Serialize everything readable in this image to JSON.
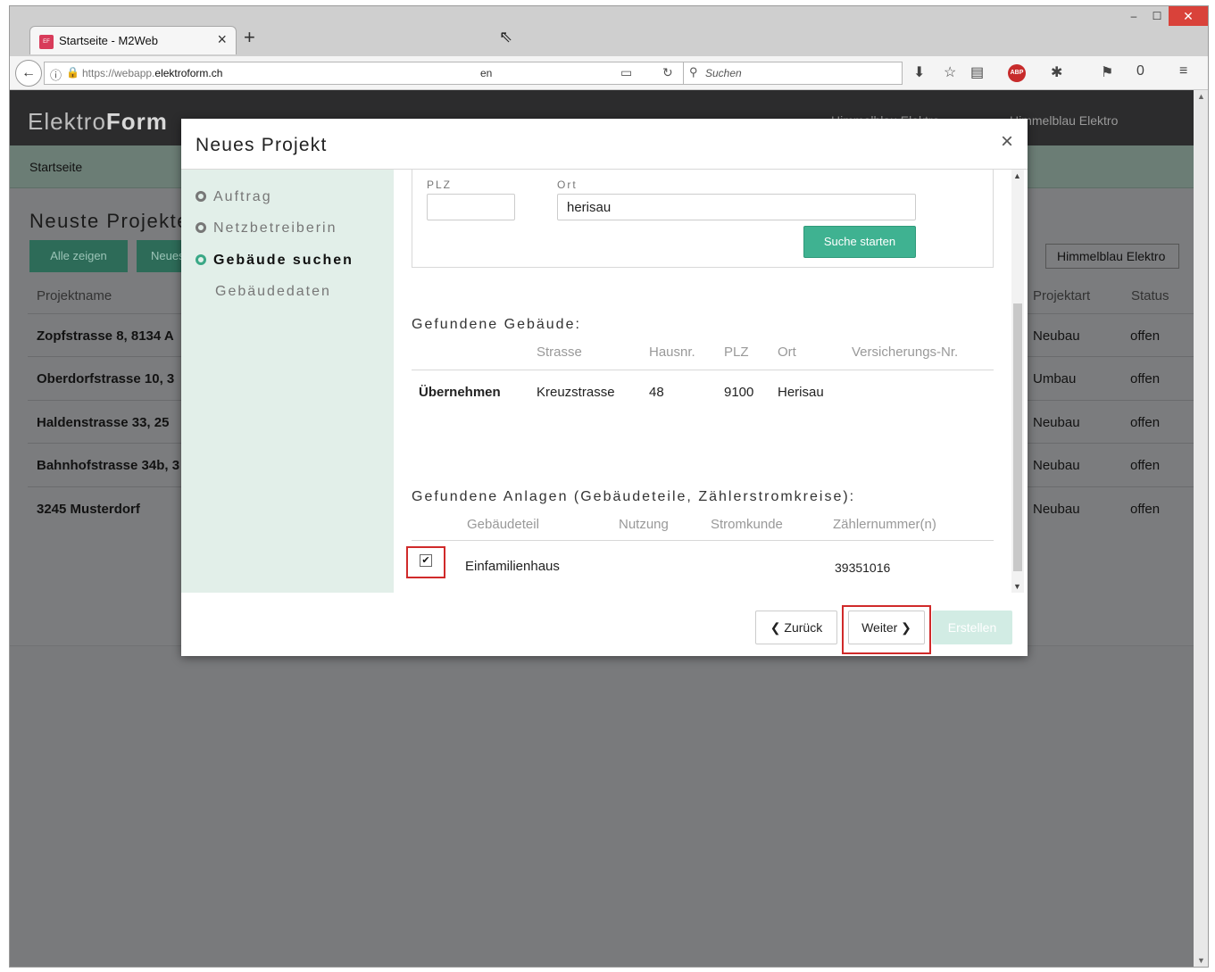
{
  "browser": {
    "tab_title": "Startseite - M2Web",
    "tab_close": "×",
    "new_tab": "+",
    "url_prefix": "https://webapp.",
    "url_domain": "elektroform.ch",
    "url_lang": "en",
    "search_placeholder": "Suchen",
    "favicon_text": "EF",
    "abp_label": "ABP",
    "badge_count": "0"
  },
  "app": {
    "logo_light": "Elektro",
    "logo_bold": "Form",
    "header_user_1": "Himmelblau Elektro",
    "header_user_2": "Himmelblau Elektro",
    "breadcrumb": "Startseite",
    "page_heading": "Neuste Projekte",
    "btn_all": "Alle zeigen",
    "btn_new": "Neues",
    "org_select": "Himmelblau Elektro",
    "columns": {
      "name": "Projektname",
      "type": "Projektart",
      "status": "Status"
    },
    "rows": [
      {
        "name": "Zopfstrasse 8, 8134 A",
        "type": "Neubau",
        "status": "offen"
      },
      {
        "name": "Oberdorfstrasse 10, 3",
        "type": "Umbau",
        "status": "offen"
      },
      {
        "name": "Haldenstrasse 33, 25",
        "type": "Neubau",
        "status": "offen"
      },
      {
        "name": "Bahnhofstrasse 34b, 3",
        "type": "Neubau",
        "status": "offen"
      },
      {
        "name": "3245 Musterdorf",
        "type": "Neubau",
        "status": "offen"
      }
    ]
  },
  "modal": {
    "title": "Neues Projekt",
    "close": "×",
    "steps": [
      "Auftrag",
      "Netzbetreiberin",
      "Gebäude suchen",
      "Gebäudedaten"
    ],
    "search": {
      "plz_label": "PLZ",
      "plz_value": "",
      "ort_label": "Ort",
      "ort_value": "herisau",
      "button": "Suche starten"
    },
    "buildings": {
      "title": "Gefundene Gebäude:",
      "headers": [
        "Strasse",
        "Hausnr.",
        "PLZ",
        "Ort",
        "Versicherungs-Nr."
      ],
      "row": {
        "action": "Übernehmen",
        "street": "Kreuzstrasse",
        "number": "48",
        "plz": "9100",
        "ort": "Herisau",
        "insurance": ""
      }
    },
    "installations": {
      "title": "Gefundene Anlagen (Gebäudeteile, Zählerstromkreise):",
      "headers": [
        "Gebäudeteil",
        "Nutzung",
        "Stromkunde",
        "Zählernummer(n)"
      ],
      "row": {
        "checked": "✔",
        "part": "Einfamilienhaus",
        "usage": "",
        "customer": "",
        "meter": "39351016"
      }
    },
    "footer": {
      "back": "Zurück",
      "next": "Weiter",
      "create": "Erstellen"
    }
  }
}
